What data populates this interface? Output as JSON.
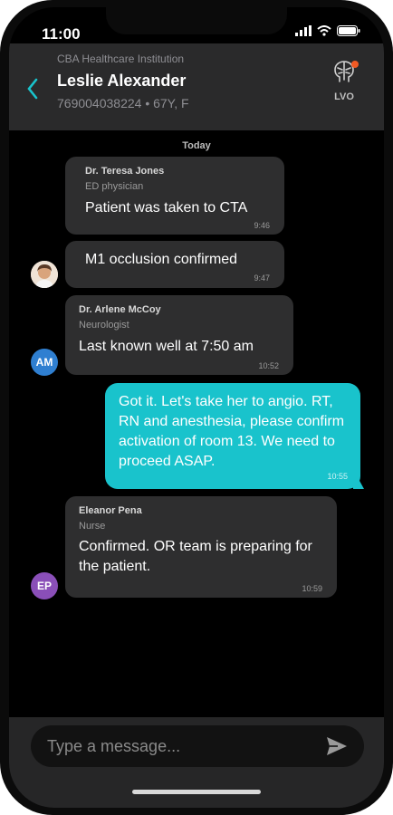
{
  "status": {
    "time": "11:00"
  },
  "header": {
    "institution": "CBA Healthcare Institution",
    "patient_name": "Leslie Alexander",
    "patient_info": "769004038224 • 67Y, F",
    "lvo_label": "LVO"
  },
  "conversation": {
    "day_label": "Today",
    "messages": [
      {
        "sender": "Dr. Teresa Jones",
        "role": "ED physician",
        "text": "Patient was taken to CTA",
        "time": "9:46"
      },
      {
        "text": "M1 occlusion confirmed",
        "time": "9:47"
      },
      {
        "sender": "Dr. Arlene McCoy",
        "role": "Neurologist",
        "avatar_initials": "AM",
        "text": "Last known well at 7:50 am",
        "time": "10:52"
      },
      {
        "text": "Got it. Let's take her to angio. RT, RN and anesthesia, please confirm activation of room 13. We need to proceed ASAP.",
        "time": "10:55",
        "outgoing": true
      },
      {
        "sender": "Eleanor Pena",
        "role": "Nurse",
        "avatar_initials": "EP",
        "text": "Confirmed. OR team is preparing for the patient.",
        "time": "10:59"
      }
    ]
  },
  "composer": {
    "placeholder": "Type a message..."
  },
  "colors": {
    "accent": "#19c3cc",
    "avatar_am": "#2f7fd1",
    "avatar_ep": "#8a4fb8",
    "notification": "#f15a24"
  }
}
